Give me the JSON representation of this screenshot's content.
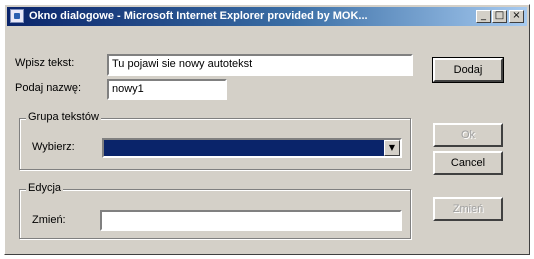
{
  "window": {
    "title": "Okno dialogowe - Microsoft Internet Explorer provided by MOK..."
  },
  "titlebar_buttons": {
    "minimize": "_",
    "maximize": "□",
    "close": "×"
  },
  "form": {
    "text_label": "Wpisz tekst:",
    "text_value": "Tu pojawi sie nowy autotekst",
    "name_label": "Podaj nazwę:",
    "name_value": "nowy1"
  },
  "group_texts": {
    "legend": "Grupa tekstów",
    "select_label": "Wybierz:",
    "select_value": ""
  },
  "group_edit": {
    "legend": "Edycja",
    "change_label": "Zmień:",
    "change_value": ""
  },
  "buttons": {
    "add": "Dodaj",
    "ok": "Ok",
    "cancel": "Cancel",
    "change": "Zmień"
  },
  "colors": {
    "titlebar_start": "#0a246a",
    "titlebar_end": "#a6caf0",
    "face": "#d4d0c8",
    "selected_fill": "#0a246a"
  },
  "icons": {
    "app": "ie-window-icon",
    "dropdown": "chevron-down-icon"
  }
}
